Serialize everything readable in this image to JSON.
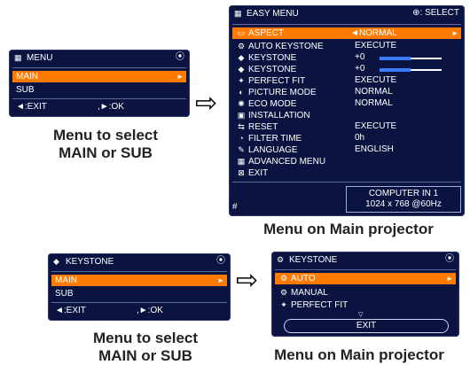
{
  "menu1": {
    "title": "MENU",
    "title_icon": "menu-icon",
    "corner": "⦿",
    "items": [
      "MAIN",
      "SUB"
    ],
    "footer_left": "◄:EXIT",
    "footer_right": ",►:OK"
  },
  "caption1": {
    "line1": "Menu to select",
    "line2": "MAIN or SUB"
  },
  "easy": {
    "title": "EASY MENU",
    "select": "⊕: SELECT",
    "items": [
      {
        "label": "ASPECT",
        "value": "◄NORMAL",
        "icon": "aspect-icon"
      },
      {
        "label": "AUTO KEYSTONE",
        "value": "EXECUTE",
        "icon": "auto-keystone-icon"
      },
      {
        "label": "KEYSTONE",
        "value": "+0",
        "icon": "keystone-v-icon"
      },
      {
        "label": "KEYSTONE",
        "value": "+0",
        "icon": "keystone-h-icon"
      },
      {
        "label": "PERFECT FIT",
        "value": "EXECUTE",
        "icon": "perfect-fit-icon"
      },
      {
        "label": "PICTURE MODE",
        "value": "NORMAL",
        "icon": "picture-mode-icon"
      },
      {
        "label": "ECO MODE",
        "value": "NORMAL",
        "icon": "eco-mode-icon"
      },
      {
        "label": "INSTALLATION",
        "value": "",
        "icon": "installation-icon"
      },
      {
        "label": "RESET",
        "value": "EXECUTE",
        "icon": "reset-icon"
      },
      {
        "label": "FILTER TIME",
        "value": "0h",
        "icon": "filter-time-icon"
      },
      {
        "label": "LANGUAGE",
        "value": "ENGLISH",
        "icon": "language-icon"
      },
      {
        "label": "ADVANCED MENU",
        "value": "",
        "icon": "advanced-menu-icon"
      },
      {
        "label": "EXIT",
        "value": "",
        "icon": "exit-icon"
      }
    ],
    "input": "COMPUTER IN 1",
    "resolution": "1024 x 768 @60Hz",
    "hash": "#"
  },
  "caption2": "Menu on Main projector",
  "menu2": {
    "title": "KEYSTONE",
    "corner": "⦿",
    "items": [
      "MAIN",
      "SUB"
    ],
    "footer_left": "◄:EXIT",
    "footer_right": ",►:OK"
  },
  "caption3": {
    "line1": "Menu to select",
    "line2": "MAIN or SUB"
  },
  "keystone": {
    "title": "KEYSTONE",
    "corner": "⦿",
    "items": [
      "AUTO",
      "MANUAL",
      "PERFECT FIT"
    ],
    "exit": "EXIT"
  },
  "caption4": "Menu on Main projector",
  "arrow": "⇨"
}
